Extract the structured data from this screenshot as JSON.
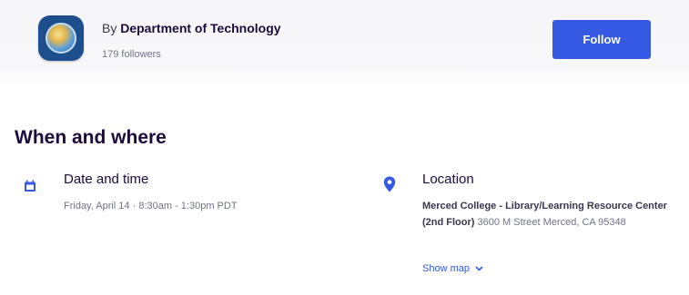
{
  "organizer": {
    "by_prefix": "By",
    "name": "Department of Technology",
    "followers": "179 followers",
    "follow_label": "Follow",
    "avatar_icon": "globe-logo-icon"
  },
  "when_where": {
    "heading": "When and where",
    "date": {
      "icon": "calendar-icon",
      "title": "Date and time",
      "value": "Friday, April 14 · 8:30am - 1:30pm PDT"
    },
    "location": {
      "icon": "map-pin-icon",
      "title": "Location",
      "venue": "Merced College - Library/Learning Resource Center (2nd Floor)",
      "address": "3600 M Street Merced, CA 95348",
      "show_map_label": "Show map",
      "show_map_icon": "chevron-down-icon"
    }
  },
  "colors": {
    "accent": "#3659e3",
    "heading": "#1e0a3c",
    "muted": "#6f7287"
  }
}
